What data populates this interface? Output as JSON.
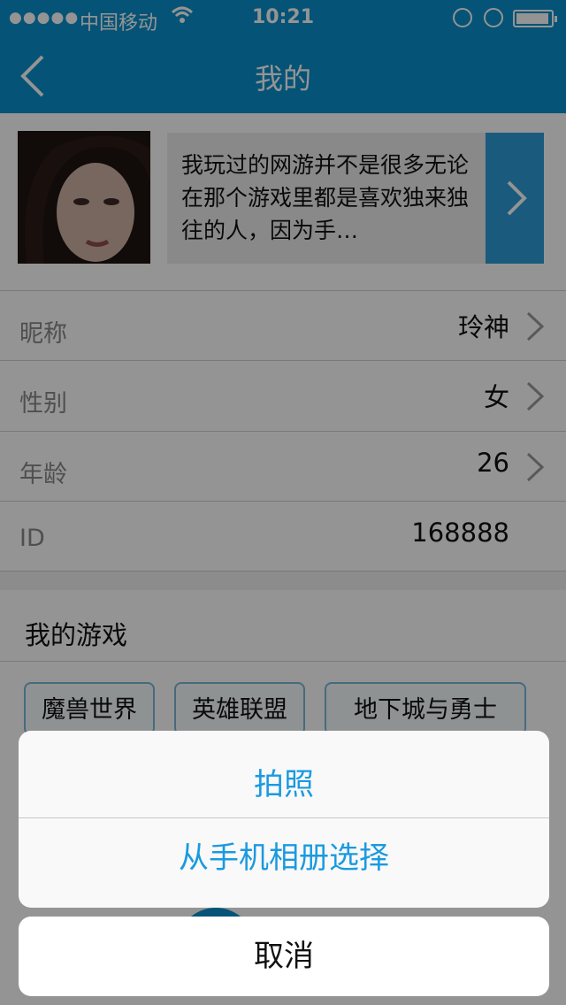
{
  "status": {
    "signal": "●●●●●",
    "carrier": "中国移动",
    "time": "10:21"
  },
  "nav": {
    "title": "我的"
  },
  "profile": {
    "bio": "我玩过的网游并不是很多无论在那个游戏里都是喜欢独来独往的人，因为手…"
  },
  "info_rows": [
    {
      "label": "昵称",
      "value": "玲神"
    },
    {
      "label": "性别",
      "value": "女"
    },
    {
      "label": "年龄",
      "value": "26"
    },
    {
      "label": "ID",
      "value": "168888"
    }
  ],
  "games": {
    "title": "我的游戏",
    "tags": [
      "魔兽世界",
      "英雄联盟",
      "地下城与勇士"
    ]
  },
  "action_sheet": {
    "options": [
      "拍照",
      "从手机相册选择"
    ],
    "cancel": "取消"
  },
  "colors": {
    "header": "#0a90cc",
    "accent": "#1a9ae0",
    "bio_arrow_bg": "#2e9bd6"
  }
}
